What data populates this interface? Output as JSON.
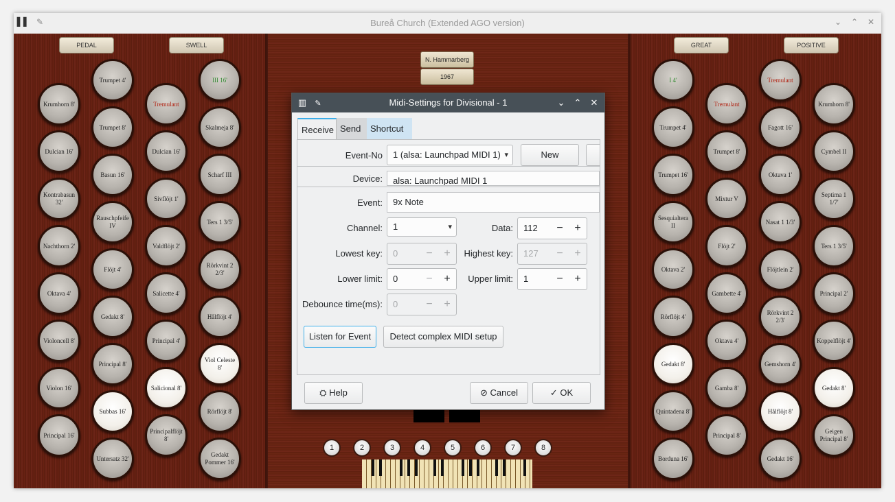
{
  "window": {
    "title": "Bureå Church (Extended AGO version)"
  },
  "divisions": {
    "pedal": "PEDAL",
    "swell": "SWELL",
    "great": "GREAT",
    "positive": "POSITIVE"
  },
  "plaques": {
    "builder": "N. Hammarberg",
    "year": "1967"
  },
  "stops": {
    "c1": [
      "Krumhorn 8'",
      "Dulcian 16'",
      "Kontrabasun 32'",
      "Nachthorn 2'",
      "Oktava 4'",
      "Violoncell 8'",
      "Violon 16'",
      "Principal 16'"
    ],
    "c2": [
      "Trumpet 4'",
      "Trumpet 8'",
      "Basun 16'",
      "Rauschpfeife IV",
      "Flöjt 4'",
      "Gedakt 8'",
      "Principal 8'",
      "Subbas 16'",
      "Untersatz 32'"
    ],
    "c3": [
      "Tremulant",
      "Dulcian 16'",
      "Sivflöjt 1'",
      "Valdflöjt 2'",
      "Salicette 4'",
      "Principal 4'",
      "Salicional 8'",
      "Principalflöjt 8'"
    ],
    "c4": [
      "III 16'",
      "Skalmeja 8'",
      "Scharf III",
      "Ters 1 3/5'",
      "Rörkvint 2 2/3'",
      "Hålflöjt 4'",
      "Viol Celeste 8'",
      "Rörflöjt 8'",
      "Gedakt Pommer 16'"
    ],
    "c5": [
      "I 4'",
      "Trumpet 4'",
      "Trumpet 16'",
      "Sesquialtera II",
      "Oktava 2'",
      "Rörflöjt 4'",
      "Gedakt 8'",
      "Quintadena 8'",
      "Borduna 16'"
    ],
    "c6": [
      "Tremulant",
      "Trumpet 8'",
      "Mixtur V",
      "Flöjt 2'",
      "Gambette 4'",
      "Oktava 4'",
      "Gamba 8'",
      "Principal 8'"
    ],
    "c7": [
      "Tremulant",
      "Fagott 16'",
      "Oktava 1'",
      "Nasat 1 1/3'",
      "Flöjtlein 2'",
      "Rörkvint 2 2/3'",
      "Gemshorn 4'",
      "Hålflöjt 8'",
      "Gedakt 16'"
    ],
    "c8": [
      "Krumhorn 8'",
      "Cymbel II",
      "Septima 1 1/7'",
      "Ters 1 3/5'",
      "Principal 2'",
      "Koppelflöjt 4'",
      "Gedakt 8'",
      "Geigen Principal 8'"
    ]
  },
  "pistons": [
    "1",
    "2",
    "3",
    "4",
    "5",
    "6",
    "7",
    "8"
  ],
  "dialog": {
    "title": "Midi-Settings for Divisional - 1",
    "tabs": [
      "Receive",
      "Send",
      "Shortcut"
    ],
    "labels": {
      "event_no": "Event-No",
      "device": "Device:",
      "event": "Event:",
      "channel": "Channel:",
      "data": "Data:",
      "lowest_key": "Lowest key:",
      "highest_key": "Highest key:",
      "lower_limit": "Lower limit:",
      "upper_limit": "Upper limit:",
      "debounce": "Debounce time(ms):"
    },
    "values": {
      "event_no": "1 (alsa: Launchpad MIDI 1)",
      "device": "alsa: Launchpad MIDI 1",
      "event": "9x Note",
      "channel": "1",
      "data": "112",
      "lowest_key": "0",
      "highest_key": "127",
      "lower_limit": "0",
      "upper_limit": "1",
      "debounce": "0"
    },
    "buttons": {
      "new": "New",
      "listen": "Listen for Event",
      "detect": "Detect complex MIDI setup",
      "help": "Help",
      "cancel": "Cancel",
      "ok": "OK"
    }
  }
}
